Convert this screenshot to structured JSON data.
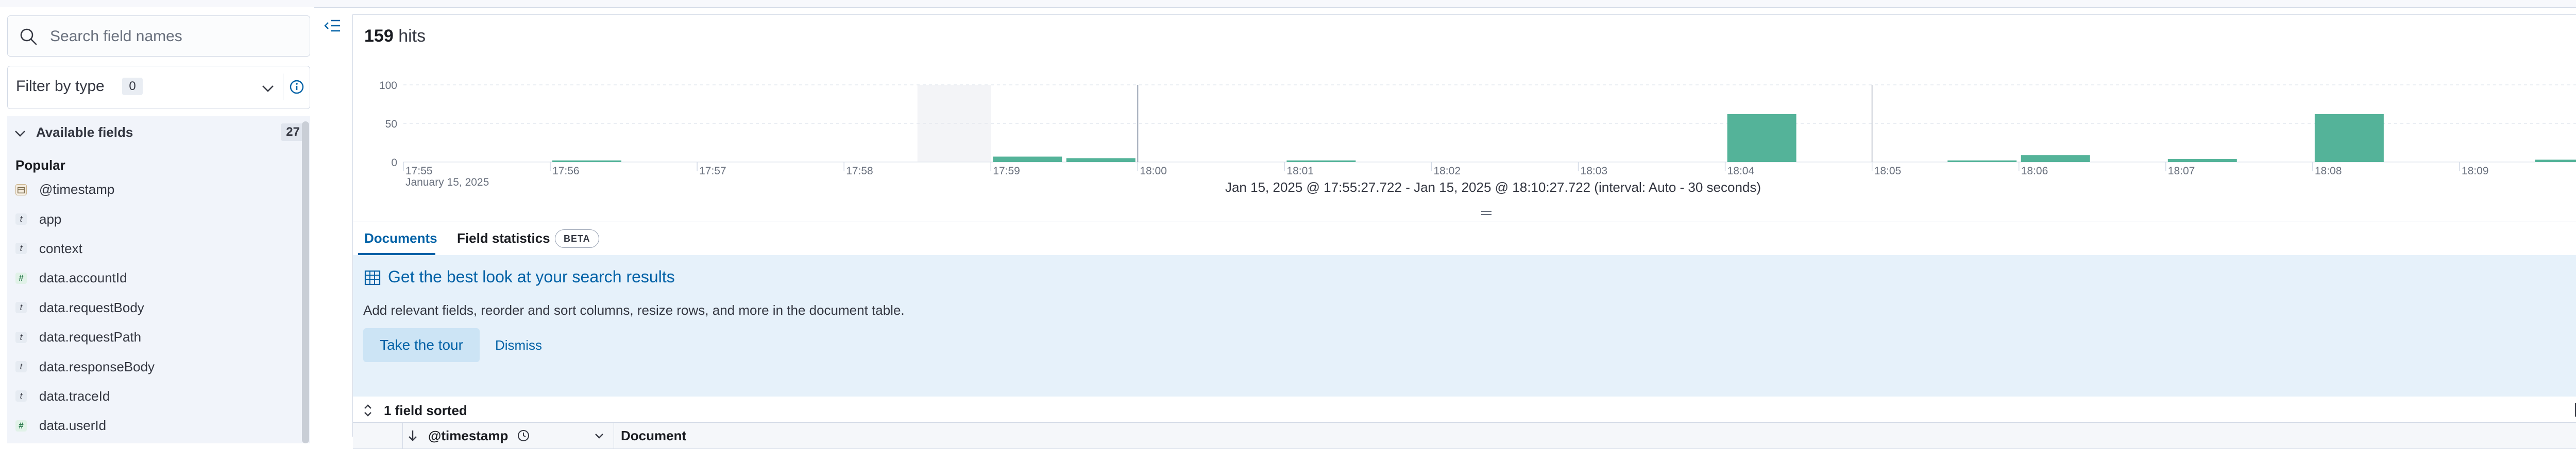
{
  "sidebar": {
    "search_placeholder": "Search field names",
    "filter_label": "Filter by type",
    "filter_count": "0",
    "available_label": "Available fields",
    "available_count": "27",
    "popular_label": "Popular",
    "fields": [
      {
        "type": "date",
        "name": "@timestamp"
      },
      {
        "type": "t",
        "name": "app"
      },
      {
        "type": "t",
        "name": "context"
      },
      {
        "type": "#",
        "name": "data.accountId"
      },
      {
        "type": "t",
        "name": "data.requestBody"
      },
      {
        "type": "t",
        "name": "data.requestPath"
      },
      {
        "type": "t",
        "name": "data.responseBody"
      },
      {
        "type": "t",
        "name": "data.traceId"
      },
      {
        "type": "#",
        "name": "data.userId"
      }
    ]
  },
  "main": {
    "hits_count": "159",
    "hits_label": "hits",
    "time_range": "Jan 15, 2025 @ 17:55:27.722 - Jan 15, 2025 @ 18:10:27.722 (interval: Auto - 30 seconds)",
    "tabs": {
      "documents": "Documents",
      "field_stats": "Field statistics",
      "beta": "BETA"
    },
    "callout": {
      "title": "Get the best look at your search results",
      "description": "Add relevant fields, reorder and sort columns, resize rows, and more in the document table.",
      "tour_button": "Take the tour",
      "dismiss": "Dismiss"
    },
    "sort_label": "1 field sorted",
    "columns": {
      "timestamp": "@timestamp",
      "document": "Document"
    }
  },
  "chart_data": {
    "type": "bar",
    "ylim": [
      0,
      100
    ],
    "yticks": [
      "100",
      "50",
      "0"
    ],
    "xticks": [
      "17:55",
      "17:56",
      "17:57",
      "17:58",
      "17:59",
      "18:00",
      "18:01",
      "18:02",
      "18:03",
      "18:04",
      "18:05",
      "18:06",
      "18:07",
      "18:08",
      "18:09",
      "18:10"
    ],
    "date_label": "January 15, 2025",
    "bar_color": "#54b399",
    "x": [
      "17:56:00",
      "17:59:00",
      "17:59:30",
      "18:01:00",
      "18:04:00",
      "18:05:30",
      "18:06:00",
      "18:07:00",
      "18:08:00",
      "18:09:30"
    ],
    "values": [
      2,
      7,
      5,
      2,
      62,
      2,
      9,
      4,
      62,
      3
    ]
  }
}
